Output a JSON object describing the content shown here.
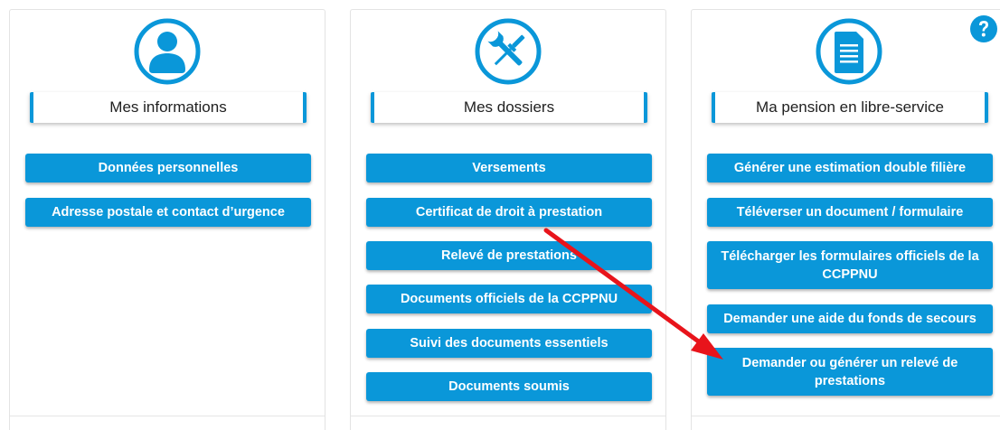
{
  "colors": {
    "accent": "#0a97d9",
    "annotation": "#e8141b"
  },
  "help": {
    "icon": "question-circle-icon"
  },
  "cards": [
    {
      "icon": "user-icon",
      "title": "Mes informations",
      "buttons": [
        "Données personnelles",
        "Adresse postale et contact d’urgence"
      ]
    },
    {
      "icon": "tools-icon",
      "title": "Mes dossiers",
      "buttons": [
        "Versements",
        "Certificat de droit à prestation",
        "Relevé de prestations",
        "Documents officiels de la CCPPNU",
        "Suivi des documents essentiels",
        "Documents soumis"
      ]
    },
    {
      "icon": "document-icon",
      "title": "Ma pension en libre-service",
      "buttons": [
        "Générer une estimation double filière",
        "Téléverser un document / formulaire",
        "Télécharger les formulaires officiels de la CCPPNU",
        "Demander une aide du fonds de secours",
        "Demander ou générer un relevé de prestations"
      ]
    }
  ]
}
